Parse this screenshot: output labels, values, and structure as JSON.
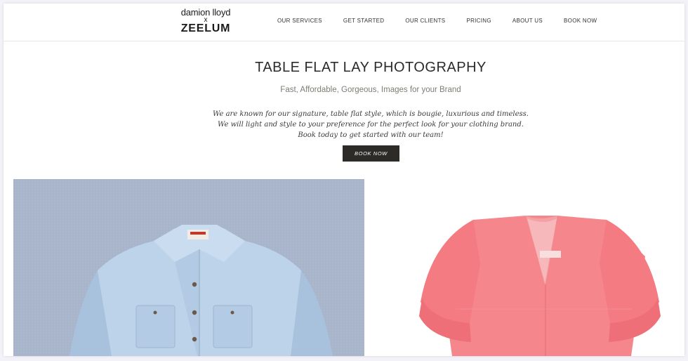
{
  "header": {
    "logo_line1": "damion lloyd",
    "logo_x": "x",
    "logo_line2": "ZEELUM",
    "nav": [
      {
        "label": "OUR SERVICES"
      },
      {
        "label": "GET STARTED"
      },
      {
        "label": "OUR CLIENTS"
      },
      {
        "label": "PRICING"
      },
      {
        "label": "ABOUT US"
      },
      {
        "label": "BOOK NOW"
      }
    ]
  },
  "hero": {
    "title": "TABLE FLAT LAY PHOTOGRAPHY",
    "subtitle": "Fast, Affordable, Gorgeous, Images for your Brand",
    "description": [
      "We are known for our signature, table flat style, which is bougie, luxurious and timeless.",
      "We will light and style to your preference for the perfect look for your clothing brand.",
      "Book today to get started with our team!"
    ],
    "cta_label": "BOOK NOW"
  },
  "gallery": {
    "left_background": "#a9b6cb",
    "left_shirt_color": "#bcd3ea",
    "right_background": "#ffffff",
    "right_top_color": "#f5868c"
  }
}
